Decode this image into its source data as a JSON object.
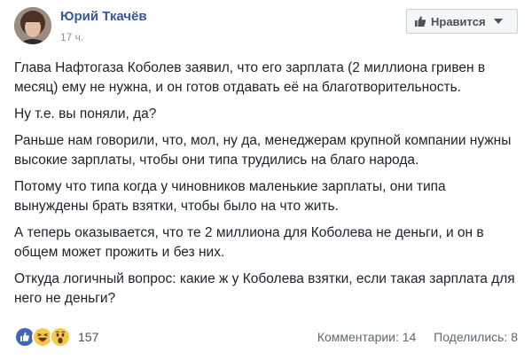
{
  "post": {
    "author": "Юрий Ткачёв",
    "time": "17 ч.",
    "like_button_label": "Нравится",
    "paragraphs": [
      "Глава Нафтогаза Коболев заявил, что его зарплата (2 миллиона гривен в месяц) ему не нужна, и он готов отдавать её на благотворительность.",
      "Ну т.е. вы поняли, да?",
      "Раньше нам говорили, что, мол, ну да, менеджерам крупной компании нужны высокие зарплаты, чтобы они типа трудились на благо народа.",
      "Потому что типа когда у чиновников маленькие зарплаты, они типа вынуждены брать взятки, чтобы было на что жить.",
      "А теперь оказывается, что те 2 миллиона для Коболева не деньги, и он в общем может прожить и без них.",
      "Откуда логичный вопрос: какие ж у Коболева взятки, если такая зарплата для него не деньги?"
    ],
    "reactions": {
      "icons": [
        "like-icon",
        "haha-icon",
        "wow-icon"
      ],
      "count": "157"
    },
    "comments": "Комментарии: 14",
    "shares": "Поделились: 8"
  },
  "colors": {
    "author_link": "#365899",
    "text": "#1d2129",
    "muted": "#90949c",
    "like_blue": "#4267b2",
    "reaction_yellow": "#f7c94a"
  }
}
